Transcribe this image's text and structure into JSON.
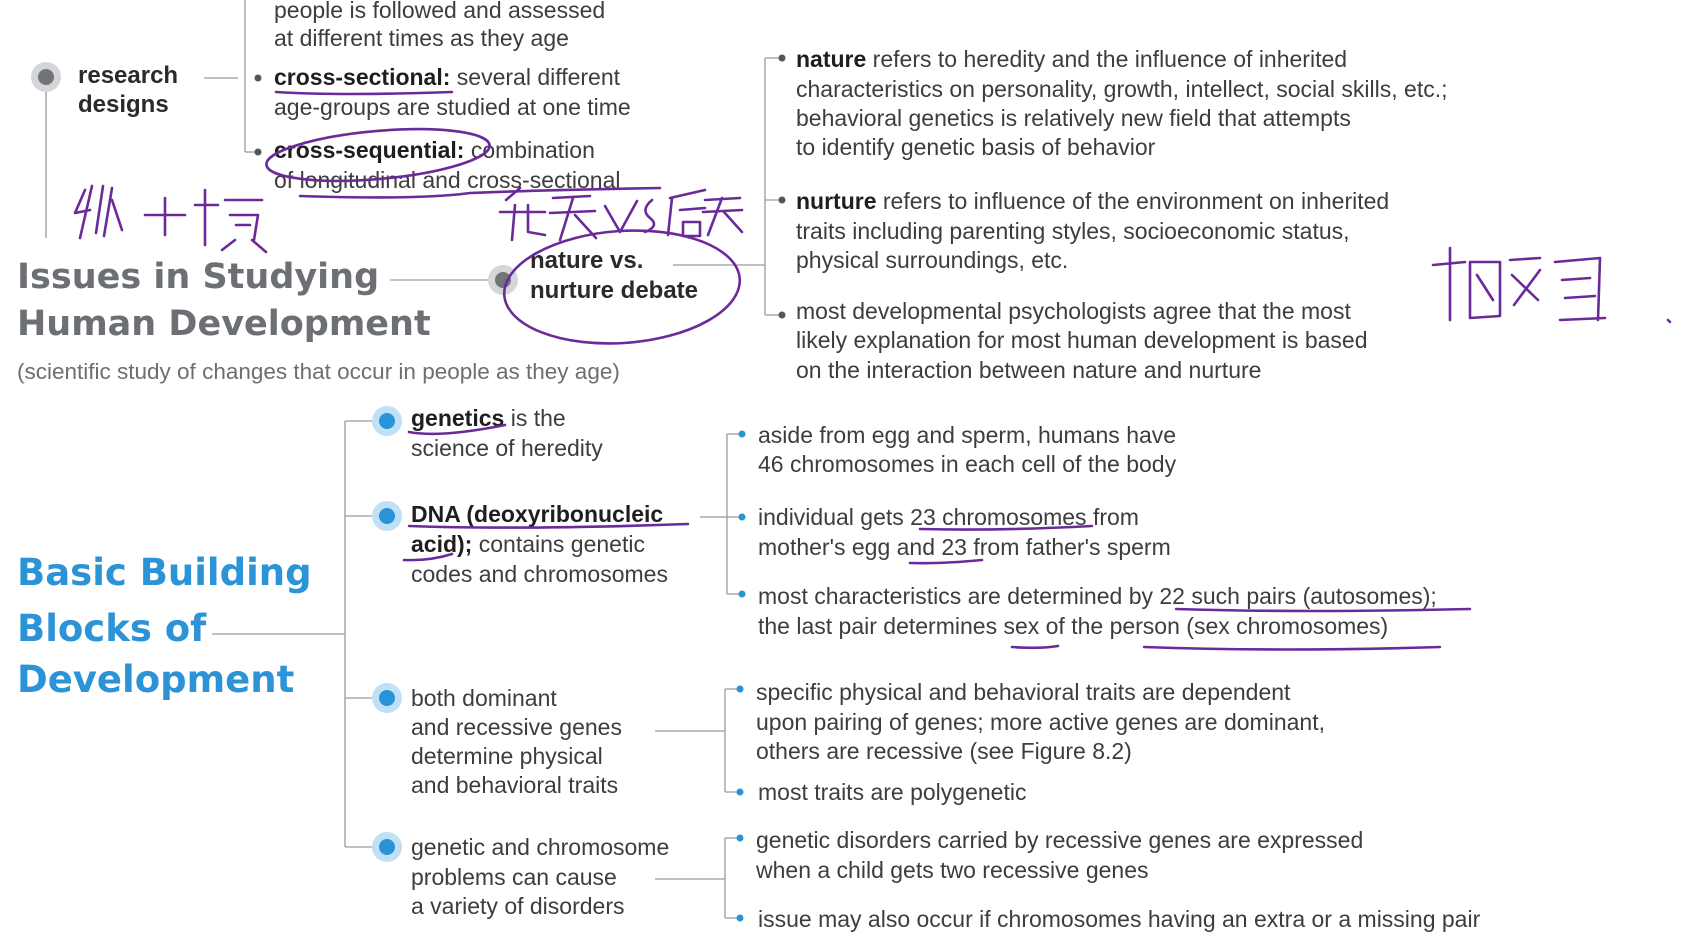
{
  "top": {
    "longitudinal_tail": [
      "people is followed and assessed",
      "at different times as they age"
    ],
    "research_designs": [
      "research",
      "designs"
    ],
    "cross_sectional": {
      "term": "cross-sectional:",
      "rest": " several different",
      "line2": "age-groups are studied at one time"
    },
    "cross_sequential": {
      "term": "cross-sequential:",
      "rest": " combination",
      "line2": "of longitudinal and cross-sectional"
    }
  },
  "issues": {
    "title": [
      "Issues in Studying",
      "Human Development"
    ],
    "subtitle": "(scientific study of changes that occur in people as they age)",
    "debate": [
      "nature vs.",
      "nurture debate"
    ]
  },
  "nature": {
    "term": "nature",
    "line1": " refers to heredity and the influence of inherited",
    "lines": [
      "characteristics on personality, growth, intellect, social skills, etc.;",
      "behavioral genetics is relatively new field that attempts",
      "to identify genetic basis of behavior"
    ]
  },
  "nurture": {
    "term": "nurture",
    "line1": " refers to influence of the environment on inherited",
    "lines": [
      "traits including parenting styles, socioeconomic status,",
      "physical surroundings, etc."
    ]
  },
  "agree": [
    "most developmental psychologists agree that the most",
    "likely explanation for most human development is based",
    "on the interaction between nature and nurture"
  ],
  "building": {
    "title": [
      "Basic Building",
      "Blocks of",
      "Development"
    ],
    "genetics": {
      "term": "genetics",
      "rest": " is the",
      "line2": "science of heredity"
    },
    "dna": {
      "term1": "DNA (deoxyribonucleic",
      "term2": "acid);",
      "rest": " contains genetic",
      "line3": "codes and chromosomes"
    },
    "dominant": [
      "both dominant",
      "and recessive genes",
      "determine physical",
      "and behavioral traits"
    ],
    "disorders": [
      "genetic and chromosome",
      "problems can cause",
      "a variety of disorders"
    ],
    "chrom1": [
      "aside from egg and sperm, humans have",
      "46 chromosomes in each cell of the body"
    ],
    "chrom2": [
      "individual gets 23 chromosomes from",
      "mother's egg and 23 from father's sperm"
    ],
    "chrom3": [
      "most characteristics are determined by 22 such pairs (autosomes);",
      "the last pair determines sex of the person (sex chromosomes)"
    ],
    "traits1": [
      "specific physical and behavioral traits are dependent",
      "upon pairing of genes; more active genes are dominant,",
      "others are recessive (see Figure 8.2)"
    ],
    "traits2": "most traits are polygenetic",
    "dis1": [
      "genetic disorders carried by recessive genes are expressed",
      "when a child gets two recessive genes"
    ],
    "dis2": "issue may also occur if chromosomes having an extra or a missing pair"
  },
  "colors": {
    "accent": "#2b93d6",
    "heading_gray": "#6c6f74",
    "ink": "#6a2a9a"
  }
}
